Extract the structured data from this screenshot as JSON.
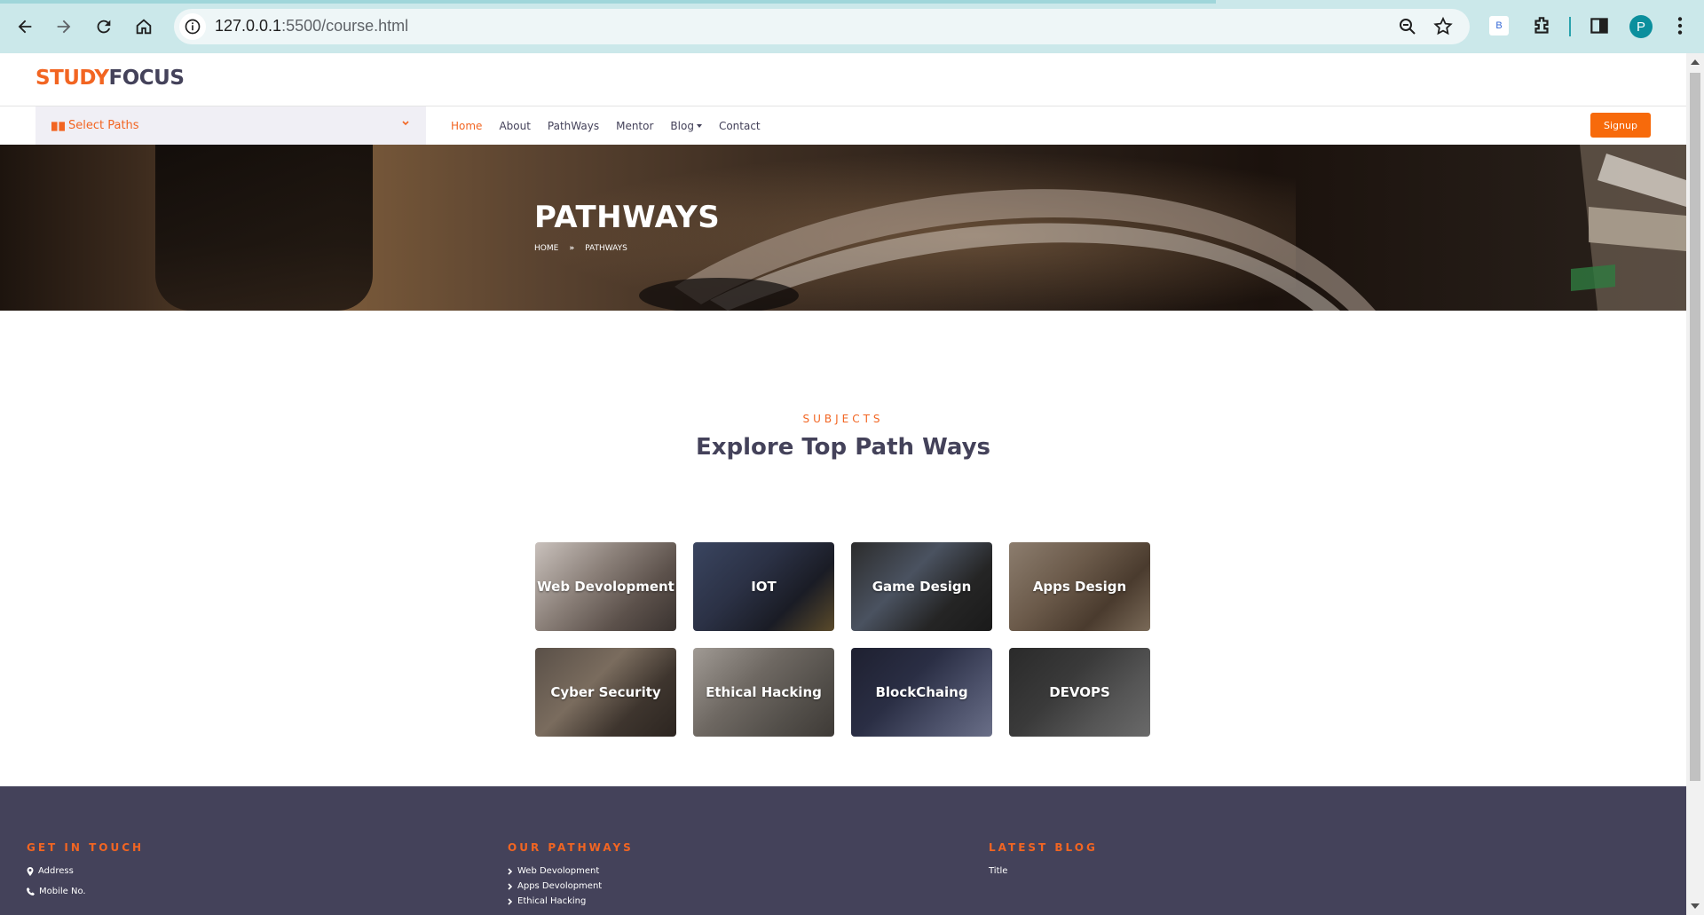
{
  "browser": {
    "url_host": "127.0.0.1",
    "url_rest": ":5500/course.html",
    "avatar_letter": "P",
    "ext_letter": "B"
  },
  "site": {
    "logo_a": "STUDY",
    "logo_b": "FOCUS",
    "select_paths": "Select Paths",
    "menu": [
      "Home",
      "About",
      "PathWays",
      "Mentor",
      "Blog",
      "Contact"
    ],
    "signup": "Signup"
  },
  "hero": {
    "title": "PATHWAYS",
    "crumb_home": "HOME",
    "crumb_sep": "»",
    "crumb_current": "PATHWAYS"
  },
  "subjects": {
    "eyebrow": "SUBJECTS",
    "heading": "Explore Top Path Ways",
    "cards": [
      {
        "label": "Web Devolopment"
      },
      {
        "label": "IOT"
      },
      {
        "label": "Game Design"
      },
      {
        "label": "Apps Design"
      },
      {
        "label": "Cyber Security"
      },
      {
        "label": "Ethical Hacking"
      },
      {
        "label": "BlockChaing"
      },
      {
        "label": "DEVOPS"
      }
    ]
  },
  "footer": {
    "touch_title": "GET IN TOUCH",
    "address": "Address",
    "mobile": "Mobile No.",
    "paths_title": "OUR PATHWAYS",
    "paths": [
      "Web Devolopment",
      "Apps Devolopment",
      "Ethical Hacking"
    ],
    "blog_title": "LATEST BLOG",
    "blog_item": "Title"
  },
  "colors": {
    "accent": "#f26522",
    "dark": "#44425a",
    "signup": "#f76a0b"
  }
}
